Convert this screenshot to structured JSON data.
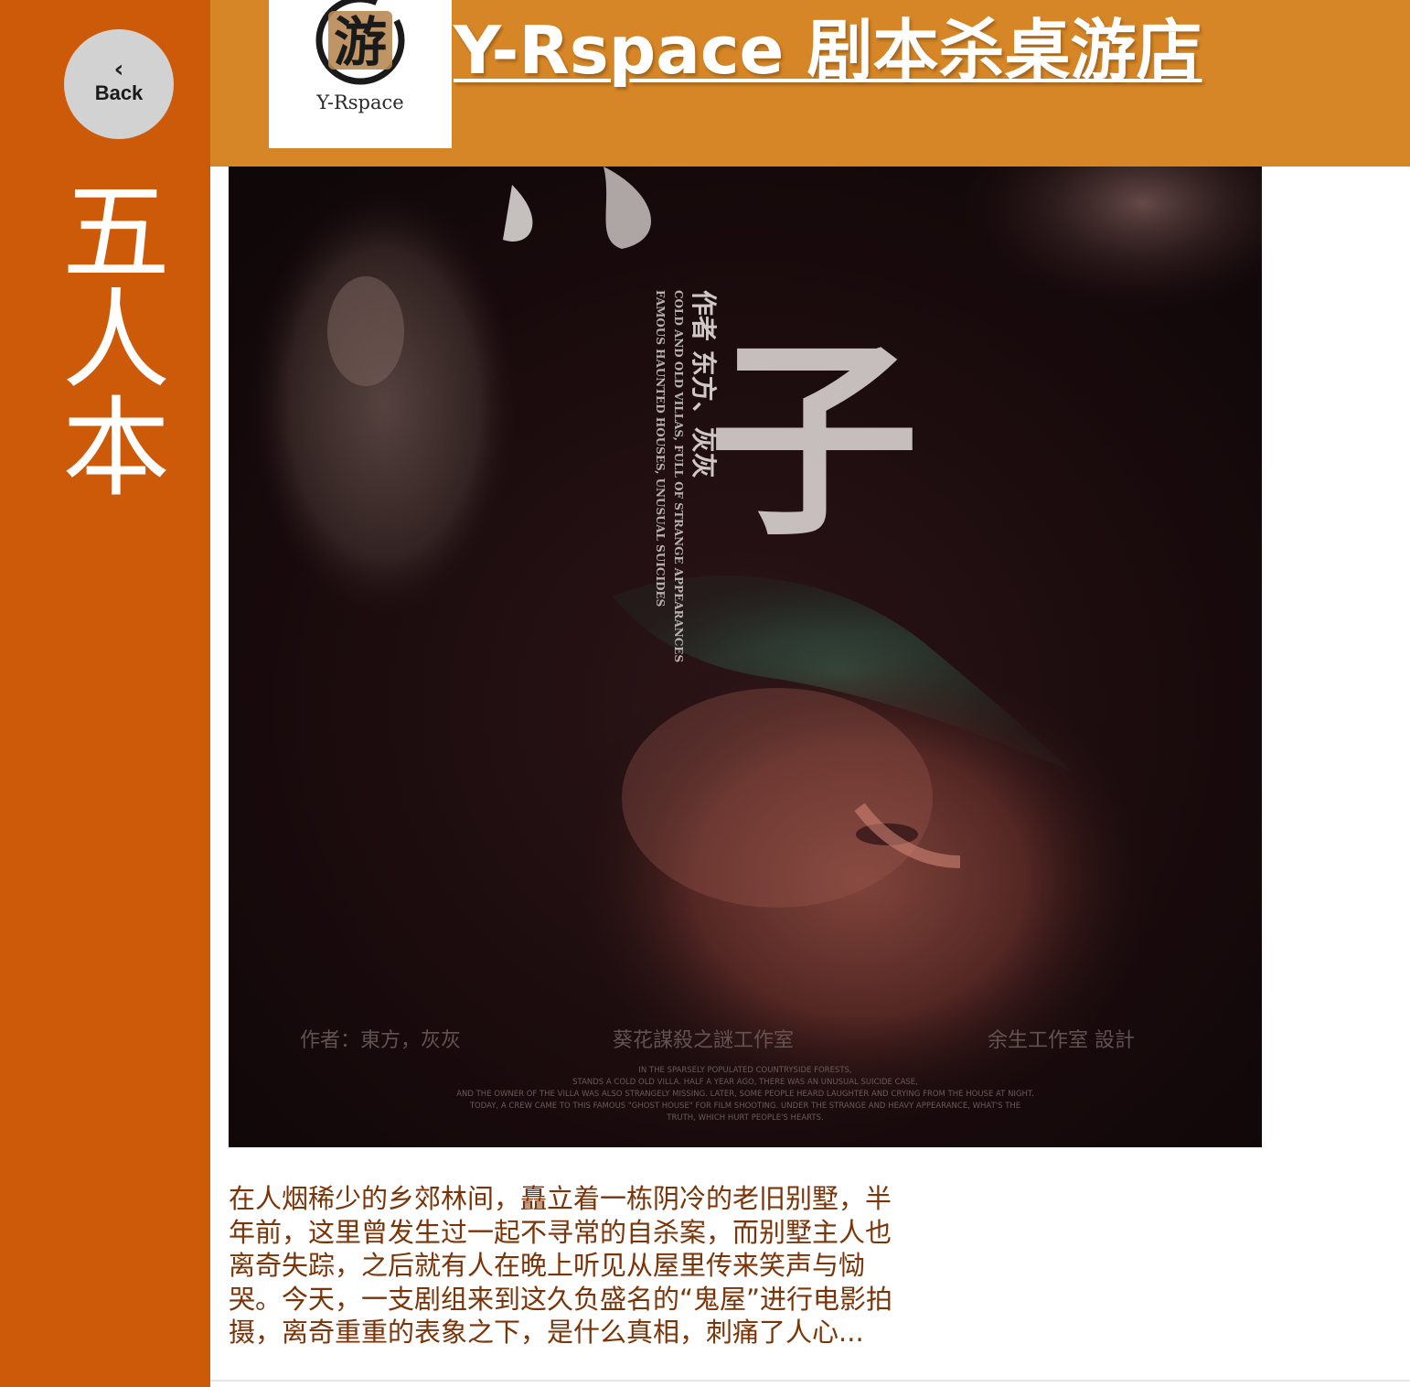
{
  "nav": {
    "back_label": "Back",
    "back_icon": "chevron-left-icon"
  },
  "sidebar": {
    "category": "五人本"
  },
  "header": {
    "logo_text": "Y-Rspace",
    "logo_glyph": "游",
    "store_title": "Y-Rspace 剧本杀桌游店"
  },
  "poster": {
    "title_glyph": "子",
    "author_vertical": "作者 东方、灰灰",
    "tagline_line1": "COLD AND OLD VILLAS, FULL OF STRANGE APPEARANCES",
    "tagline_line2": "FAMOUS HAUNTED HOUSES, UNUSUAL SUICIDES",
    "credit_author": "作者：東方，灰灰",
    "credit_studio": "葵花謀殺之謎工作室",
    "credit_design": "余生工作室 設計",
    "synopsis_en_1": "IN THE SPARSELY POPULATED COUNTRYSIDE FORESTS,",
    "synopsis_en_2": "STANDS A COLD OLD VILLA. HALF A YEAR AGO, THERE WAS AN UNUSUAL SUICIDE CASE,",
    "synopsis_en_3": "AND THE OWNER OF THE VILLA WAS ALSO STRANGELY MISSING. LATER, SOME PEOPLE HEARD LAUGHTER AND CRYING FROM THE HOUSE AT NIGHT.",
    "synopsis_en_4": "TODAY, A CREW CAME TO THIS FAMOUS \"GHOST HOUSE\" FOR FILM SHOOTING. UNDER THE STRANGE AND HEAVY APPEARANCE, WHAT'S THE",
    "synopsis_en_5": "TRUTH, WHICH HURT PEOPLE'S HEARTS."
  },
  "description": "在人烟稀少的乡郊林间，矗立着一栋阴冷的老旧别墅，半年前，这里曾发生过一起不寻常的自杀案，而别墅主人也离奇失踪，之后就有人在晚上听见从屋里传来笑声与恸哭。今天，一支剧组来到这久负盛名的“鬼屋”进行电影拍摄，离奇重重的表象之下，是什么真相，刺痛了人心..."
}
